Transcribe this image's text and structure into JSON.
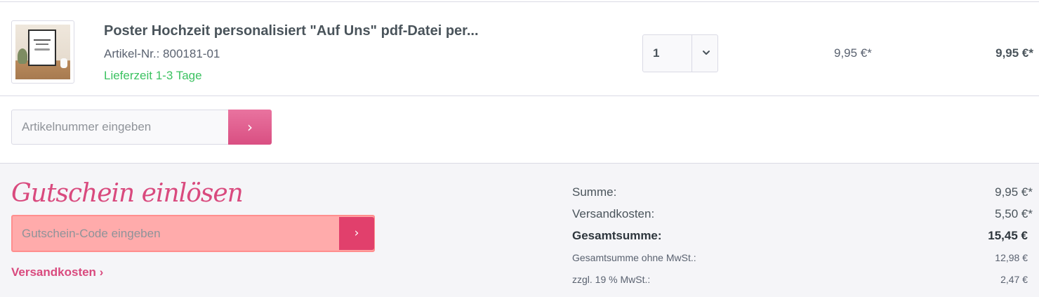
{
  "line_item": {
    "title": "Poster Hochzeit personalisiert \"Auf Uns\" pdf-Datei per...",
    "article_number": "Artikel-Nr.: 800181-01",
    "delivery_time": "Lieferzeit 1-3 Tage",
    "quantity": "1",
    "unit_price": "9,95 €*",
    "total_price": "9,95 €*",
    "thumbnail_icon": "product-poster-thumbnail"
  },
  "add_product": {
    "placeholder": "Artikelnummer eingeben",
    "button_icon": "chevron-right",
    "button_glyph": "›"
  },
  "voucher": {
    "title": "Gutschein einlösen",
    "placeholder": "Gutschein-Code eingeben",
    "button_glyph": "›"
  },
  "shipping_link": "Versandkosten ›",
  "summary": {
    "sum_label": "Summe:",
    "sum_value": "9,95 €*",
    "shipping_label": "Versandkosten:",
    "shipping_value": "5,50 €*",
    "total_label": "Gesamtsumme:",
    "total_value": "15,45 €",
    "net_label": "Gesamtsumme ohne MwSt.:",
    "net_value": "12,98 €",
    "tax_label": "zzgl. 19 % MwSt.:",
    "tax_value": "2,47 €"
  },
  "colors": {
    "accent": "#d94a7e",
    "delivery_green": "#3cc261",
    "voucher_highlight": "#ffabab"
  }
}
